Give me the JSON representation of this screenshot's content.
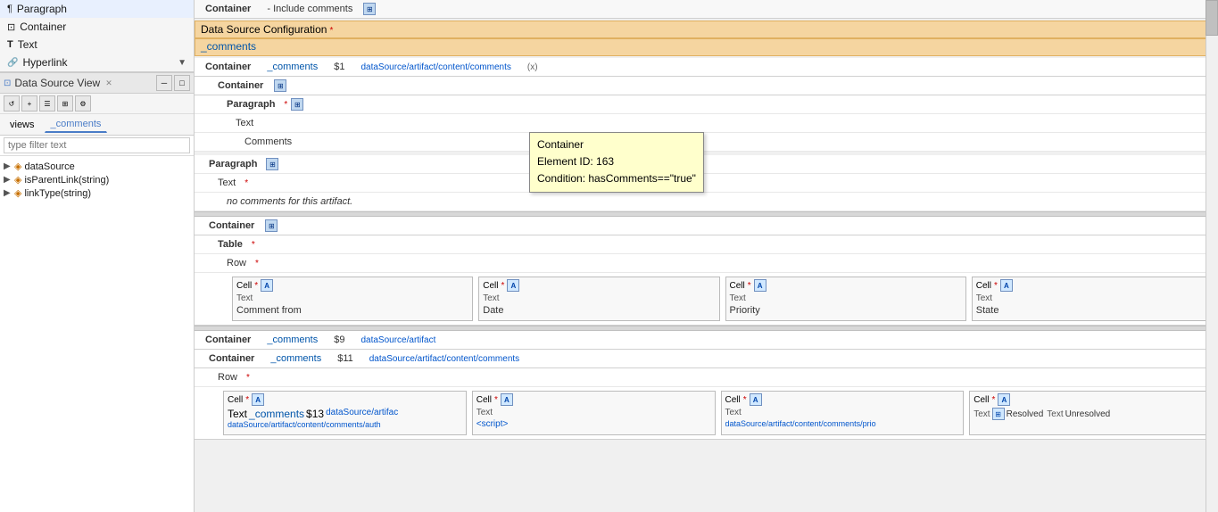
{
  "sidebar": {
    "items": [
      {
        "icon": "¶",
        "label": "Paragraph"
      },
      {
        "icon": "☐",
        "label": "Container"
      },
      {
        "icon": "T",
        "label": "Text"
      },
      {
        "icon": "🔗",
        "label": "Hyperlink"
      }
    ],
    "datasource_view": {
      "title": "Data Source View",
      "tabs": [
        "views",
        "_comments"
      ],
      "active_tab": "_comments",
      "filter_placeholder": "type filter text",
      "tree_items": [
        {
          "label": "dataSource",
          "has_children": true,
          "indent": 0
        },
        {
          "label": "isParentLink(string)",
          "has_children": true,
          "indent": 0
        },
        {
          "label": "linkType(string)",
          "has_children": true,
          "indent": 0
        }
      ]
    }
  },
  "main": {
    "top_container": {
      "label": "Container",
      "dash_label": "- Include comments",
      "icon": "⊞"
    },
    "datasource_config": {
      "title": "Data Source Configuration",
      "asterisk": "*",
      "value": "_comments"
    },
    "comments_container": {
      "label": "Container",
      "binding": "_comments",
      "dollar": "$1",
      "path": "dataSource/artifact/content/comments",
      "paren": "(x)"
    },
    "inner_container": {
      "label": "Container",
      "icon": "⊞"
    },
    "paragraph_row": {
      "label": "Paragraph",
      "asterisk": "*",
      "icon": "⊞"
    },
    "text_row": {
      "label": "Text"
    },
    "comments_text": {
      "label": "Comments"
    },
    "tooltip": {
      "title": "Container",
      "element_id": "Element ID: 163",
      "condition": "Condition: hasComments==\"true\""
    },
    "paragraph2": {
      "label": "Paragraph",
      "icon": "⊞"
    },
    "text_star": {
      "label": "Text",
      "asterisk": "*"
    },
    "no_comments": {
      "text": "no comments for this artifact."
    },
    "container2": {
      "label": "Container",
      "icon": "⊞"
    },
    "table": {
      "label": "Table",
      "asterisk": "*"
    },
    "row_header": {
      "label": "Row",
      "asterisk": "*"
    },
    "header_cells": [
      {
        "label": "Cell",
        "asterisk": "*",
        "text": "Comment from"
      },
      {
        "label": "Cell",
        "asterisk": "*",
        "text": "Date"
      },
      {
        "label": "Cell",
        "asterisk": "*",
        "text": "Priority"
      },
      {
        "label": "Cell",
        "asterisk": "*",
        "text": "State"
      }
    ],
    "container3": {
      "label": "Container",
      "binding": "_comments",
      "dollar": "$9",
      "path": "dataSource/artifact"
    },
    "container4": {
      "label": "Container",
      "binding": "_comments",
      "dollar": "$11",
      "path": "dataSource/artifact/content/comments"
    },
    "row2": {
      "label": "Row",
      "asterisk": "*"
    },
    "data_cells": [
      {
        "label": "Cell",
        "asterisk": "*",
        "text_label": "Text",
        "binding": "_comments",
        "dollar": "$13",
        "path_short": "dataSource/artifac",
        "path_full": "dataSource/artifact/content/comments/auth",
        "has_icon": true
      },
      {
        "label": "Cell",
        "asterisk": "*",
        "text_label": "Text",
        "value": "<script>",
        "has_icon": false
      },
      {
        "label": "Cell",
        "asterisk": "*",
        "text_label": "Text",
        "path_full": "dataSource/artifact/content/comments/prio",
        "has_icon": false
      },
      {
        "label": "Cell",
        "asterisk": "*",
        "text_label1": "Text",
        "text_label2": "Text",
        "value1": "Resolved",
        "value2": "Unresolved",
        "has_icon": true
      }
    ]
  }
}
